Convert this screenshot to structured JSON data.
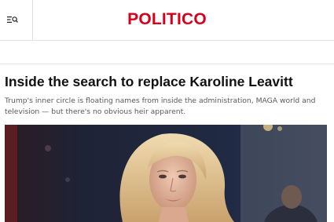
{
  "header": {
    "logo_text": "POLITICO",
    "logo_color": "#d6001c",
    "menu_icon": "menu-search-icon"
  },
  "article": {
    "headline": "Inside the search to replace Karoline Leavitt",
    "dek": "Trump's inner circle is floating names from inside the administration, MAGA world and television — but there's no obvious heir apparent.",
    "image_alt": "lead-photo"
  }
}
